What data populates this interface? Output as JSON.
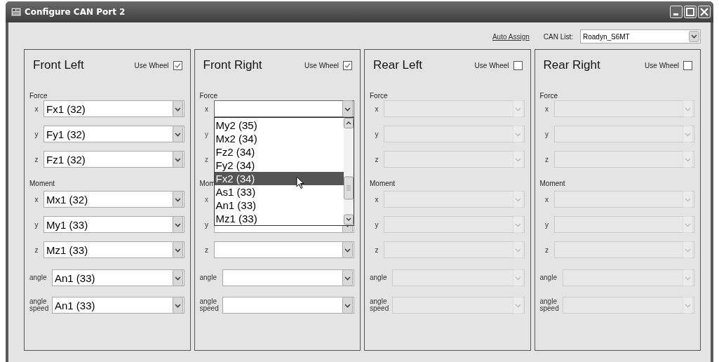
{
  "window": {
    "title": "Configure CAN Port 2"
  },
  "toolbar": {
    "auto_assign": "Auto Assign",
    "can_list_label": "CAN List:",
    "can_list_value": "Roadyn_S6MT"
  },
  "panels": [
    {
      "title": "Front Left",
      "use_wheel_label": "Use Wheel",
      "use_wheel": true,
      "disabled": false,
      "groups": [
        {
          "label": "Force",
          "rows": [
            {
              "axis": "x",
              "value": "Fx1 (32)"
            },
            {
              "axis": "y",
              "value": "Fy1 (32)"
            },
            {
              "axis": "z",
              "value": "Fz1 (32)"
            }
          ]
        },
        {
          "label": "Moment",
          "rows": [
            {
              "axis": "x",
              "value": "Mx1 (32)"
            },
            {
              "axis": "y",
              "value": "My1 (33)"
            },
            {
              "axis": "z",
              "value": "Mz1 (33)"
            }
          ]
        },
        {
          "kind": "single",
          "rows": [
            {
              "axis": "angle",
              "value": "An1 (33)"
            },
            {
              "axis": "angle speed",
              "value": "An1 (33)"
            }
          ]
        }
      ]
    },
    {
      "title": "Front Right",
      "use_wheel_label": "Use Wheel",
      "use_wheel": true,
      "disabled": false,
      "groups": [
        {
          "label": "Force",
          "rows": [
            {
              "axis": "x",
              "open": true
            },
            {
              "axis": "y",
              "covered": true
            },
            {
              "axis": "z",
              "covered": true
            }
          ]
        },
        {
          "label": "Mom",
          "rows": [
            {
              "axis": "x",
              "covered": true
            },
            {
              "axis": "y"
            },
            {
              "axis": "z"
            }
          ]
        },
        {
          "kind": "single",
          "rows": [
            {
              "axis": "angle"
            },
            {
              "axis": "angle speed"
            }
          ]
        }
      ],
      "dropdown": [
        {
          "label": "My2 (35)",
          "selected": false
        },
        {
          "label": "Mx2 (34)",
          "selected": false
        },
        {
          "label": "Fz2 (34)",
          "selected": false
        },
        {
          "label": "Fy2 (34)",
          "selected": false
        },
        {
          "label": "Fx2 (34)",
          "selected": true
        },
        {
          "label": "As1 (33)",
          "selected": false
        },
        {
          "label": "An1 (33)",
          "selected": false
        },
        {
          "label": "Mz1 (33)",
          "selected": false
        }
      ]
    },
    {
      "title": "Rear Left",
      "use_wheel_label": "Use Wheel",
      "use_wheel": false,
      "disabled": true,
      "groups": [
        {
          "label": "Force",
          "rows": [
            {
              "axis": "x"
            },
            {
              "axis": "y"
            },
            {
              "axis": "z"
            }
          ]
        },
        {
          "label": "Moment",
          "rows": [
            {
              "axis": "x"
            },
            {
              "axis": "y"
            },
            {
              "axis": "z"
            }
          ]
        },
        {
          "kind": "single",
          "rows": [
            {
              "axis": "angle"
            },
            {
              "axis": "angle speed"
            }
          ]
        }
      ]
    },
    {
      "title": "Rear Right",
      "use_wheel_label": "Use Wheel",
      "use_wheel": false,
      "disabled": true,
      "groups": [
        {
          "label": "Force",
          "rows": [
            {
              "axis": "x"
            },
            {
              "axis": "y"
            },
            {
              "axis": "z"
            }
          ]
        },
        {
          "label": "Moment",
          "rows": [
            {
              "axis": "x"
            },
            {
              "axis": "y"
            },
            {
              "axis": "z"
            }
          ]
        },
        {
          "kind": "single",
          "rows": [
            {
              "axis": "angle"
            },
            {
              "axis": "angle speed"
            }
          ]
        }
      ]
    }
  ]
}
